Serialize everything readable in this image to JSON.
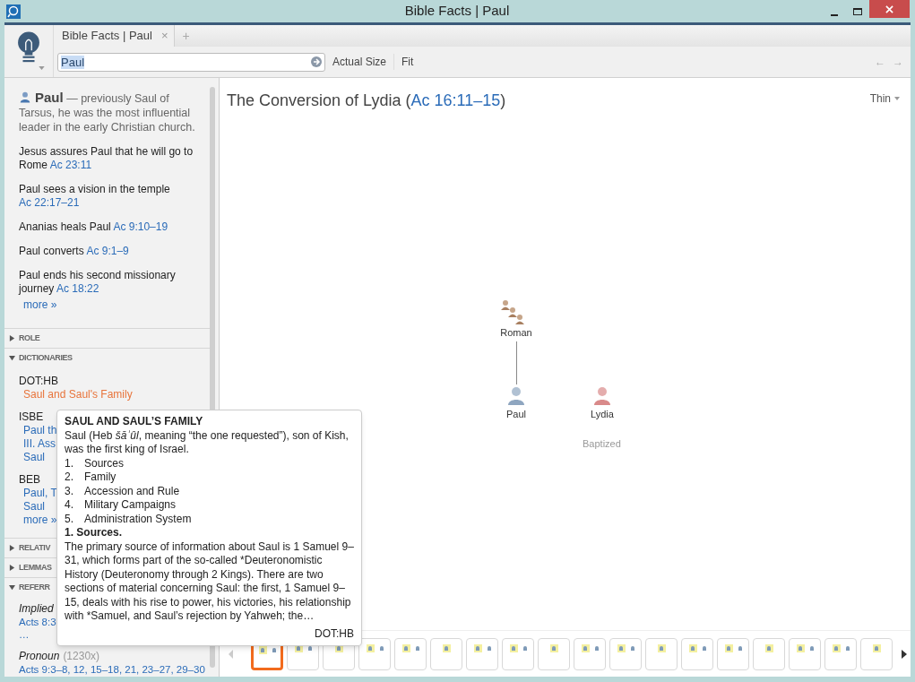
{
  "window": {
    "title": "Bible Facts | Paul"
  },
  "tabs": [
    {
      "label": "Bible Facts | Paul",
      "selected": true,
      "close": "×"
    }
  ],
  "new_tab": "+",
  "search": {
    "value": "Paul"
  },
  "toolbar": [
    "Actual Size",
    "Fit"
  ],
  "nav": {
    "back": "←",
    "forward": "→"
  },
  "sidebar": {
    "name": "Paul",
    "description": " — previously Saul of Tarsus, he was the most influential leader in the early Christian church.",
    "events": [
      {
        "text": "Jesus assures Paul that he will go to Rome ",
        "ref": "Ac 23:11"
      },
      {
        "text": "Paul sees a vision in the temple ",
        "ref": "Ac 22:17–21"
      },
      {
        "text": "Ananias heals Paul ",
        "ref": "Ac 9:10–19"
      },
      {
        "text": "Paul converts ",
        "ref": "Ac 9:1–9"
      },
      {
        "text": "Paul ends his second missionary journey ",
        "ref": "Ac 18:22"
      }
    ],
    "more": "more »",
    "sections": [
      {
        "title": "ROLE",
        "expanded": false
      },
      {
        "title": "DICTIONARIES",
        "expanded": true,
        "kind": "dictionaries",
        "groups": [
          {
            "source": "DOT:HB",
            "links": [
              {
                "text": "Saul and Saul's Family",
                "selected": true
              }
            ]
          },
          {
            "source": "ISBE",
            "links": [
              {
                "text": "Paul th",
                "selected": false
              },
              {
                "text": "III. Ass",
                "selected": false
              },
              {
                "text": "Saul",
                "selected": false
              }
            ]
          },
          {
            "source": "BEB",
            "links": [
              {
                "text": "Paul, T",
                "selected": false
              },
              {
                "text": "Saul",
                "selected": false
              }
            ]
          }
        ],
        "more": "more »"
      },
      {
        "title": "RELATIV",
        "expanded": false
      },
      {
        "title": "LEMMAS",
        "expanded": false
      },
      {
        "title": "REFERR",
        "expanded": true,
        "kind": "references",
        "refs": [
          {
            "label": "Implied",
            "refs": [
              "Acts 8:3",
              "…"
            ]
          },
          {
            "label": "Pronoun",
            "count": "(1230x)",
            "refs": [
              "Acts 9:3–8, 12, 15–18, 21, 23–27, 29–30"
            ]
          }
        ]
      }
    ]
  },
  "canvas": {
    "title": "The Conversion of Lydia (",
    "ref": "Ac 16:11–15",
    "title_end": ")",
    "style_menu": "Thin",
    "nodes": [
      {
        "label": "Roman",
        "kind": "group"
      },
      {
        "label": "Paul",
        "kind": "person",
        "color": "#8fa6c0"
      },
      {
        "label": "Lydia",
        "kind": "person",
        "color": "#d98a8a"
      }
    ],
    "caption": "Baptized"
  },
  "thumbnails": [
    {
      "selected": true
    },
    {
      "selected": false
    },
    {
      "selected": false
    },
    {
      "selected": false
    },
    {
      "selected": false
    },
    {
      "selected": false
    },
    {
      "selected": false
    },
    {
      "selected": false
    },
    {
      "selected": false
    },
    {
      "selected": false
    },
    {
      "selected": false
    },
    {
      "selected": false
    },
    {
      "selected": false
    },
    {
      "selected": false
    },
    {
      "selected": false
    },
    {
      "selected": false
    },
    {
      "selected": false
    },
    {
      "selected": false
    }
  ],
  "tooltip": {
    "heading": "SAUL AND SAUL’S FAMILY",
    "intro": "Saul (Heb *šāʾûl*, meaning “the one requested”), son of Kish, was the first king of Israel.",
    "list": [
      {
        "num": "1.",
        "text": "Sources"
      },
      {
        "num": "2.",
        "text": "Family"
      },
      {
        "num": "3.",
        "text": "Accession and Rule"
      },
      {
        "num": "4.",
        "text": "Military Campaigns"
      },
      {
        "num": "5.",
        "text": "Administration System"
      }
    ],
    "subheading": "1. Sources.",
    "body": "The primary source of information about Saul is 1 Samuel 9–31, which forms part of the so-called *Deuteronomistic History (Deuteronomy through 2 Kings). There are two sections of material concerning Saul: the first, 1 Samuel 9–15, deals with his rise to power, his victories, his relationship with *Samuel, and Saul’s rejection by Yahweh; the…",
    "source": "DOT:HB"
  }
}
